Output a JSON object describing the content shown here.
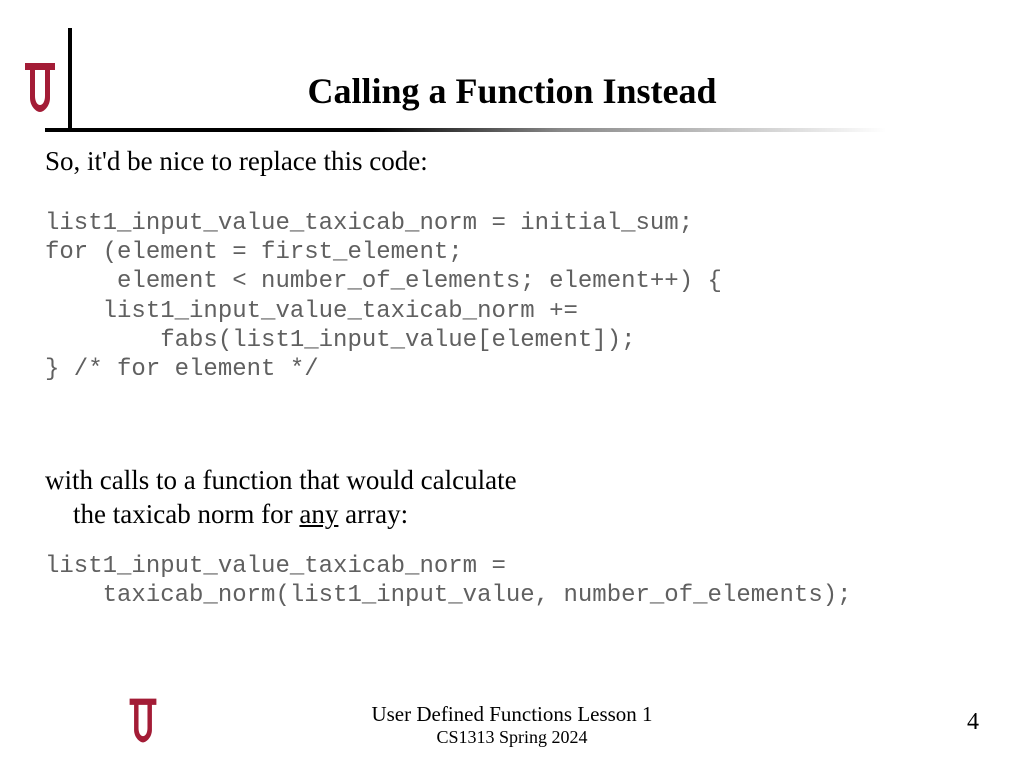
{
  "title": "Calling a Function Instead",
  "intro": "So, it'd be nice to replace this code:",
  "code1": "list1_input_value_taxicab_norm = initial_sum;\nfor (element = first_element;\n     element < number_of_elements; element++) {\n    list1_input_value_taxicab_norm +=\n        fabs(list1_input_value[element]);\n} /* for element */",
  "mid_line1": "with calls to a function that would calculate",
  "mid_line2_pre": "the taxicab norm for ",
  "mid_line2_any": "any",
  "mid_line2_post": " array:",
  "code2": "list1_input_value_taxicab_norm =\n    taxicab_norm(list1_input_value, number_of_elements);",
  "footer_title": "User Defined Functions Lesson 1",
  "footer_sub": "CS1313 Spring 2024",
  "page": "4",
  "logo_color": "#a31c36"
}
